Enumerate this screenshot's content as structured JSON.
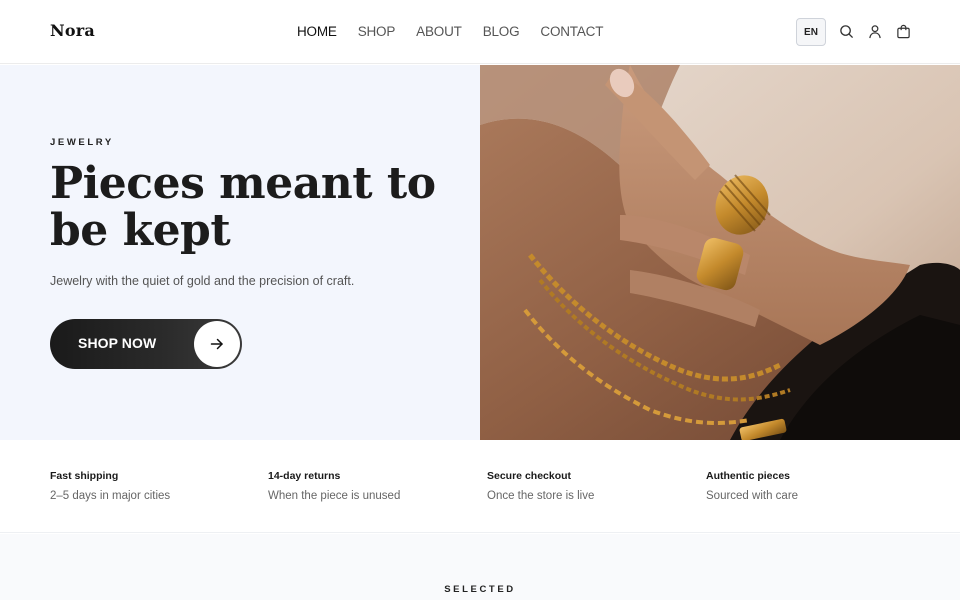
{
  "brand": {
    "name": "Nora"
  },
  "nav": {
    "items": [
      {
        "label": "HOME",
        "active": true
      },
      {
        "label": "SHOP",
        "active": false
      },
      {
        "label": "ABOUT",
        "active": false
      },
      {
        "label": "BLOG",
        "active": false
      },
      {
        "label": "CONTACT",
        "active": false
      }
    ]
  },
  "header_actions": {
    "language": "EN",
    "icons": [
      "search-icon",
      "account-icon",
      "cart-icon"
    ]
  },
  "hero": {
    "eyebrow": "JEWELRY",
    "title": "Pieces meant to be kept",
    "subtitle": "Jewelry with the quiet of gold and the precision of craft.",
    "cta_label": "SHOP NOW",
    "cta_icon": "arrow-right-icon",
    "background_color": "#f3f6fd"
  },
  "features": [
    {
      "title": "Fast shipping",
      "description": "2–5 days in major cities"
    },
    {
      "title": "14-day returns",
      "description": "When the piece is unused"
    },
    {
      "title": "Secure checkout",
      "description": "Once the store is live"
    },
    {
      "title": "Authentic pieces",
      "description": "Sourced with care"
    }
  ],
  "section": {
    "label": "SELECTED"
  },
  "colors": {
    "accent": "#1a1a1a",
    "gold": "#c48a2c"
  }
}
